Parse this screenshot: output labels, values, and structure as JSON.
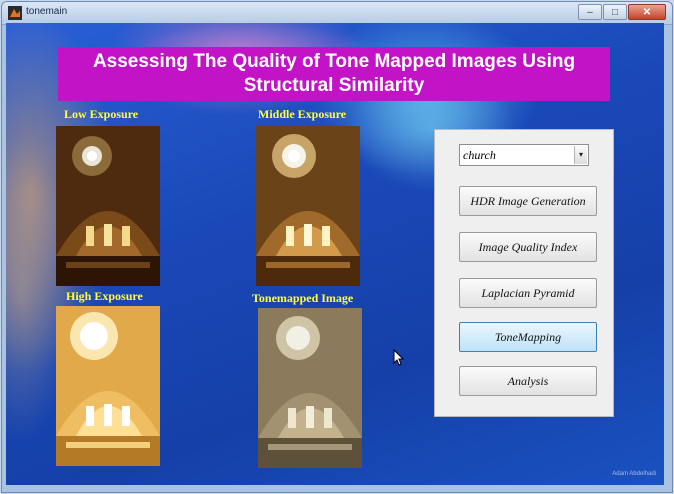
{
  "window": {
    "title": "tonemain",
    "buttons": {
      "minimize": "–",
      "maximize": "□",
      "close": "✕"
    }
  },
  "banner": {
    "line1": "Assessing The Quality of Tone Mapped Images Using",
    "line2": "Structural Similarity"
  },
  "images": {
    "low": {
      "label": "Low Exposure"
    },
    "middle": {
      "label": "Middle Exposure"
    },
    "high": {
      "label": "High Exposure"
    },
    "tonemapped": {
      "label": "Tonemapped Image"
    }
  },
  "panel": {
    "dropdown": {
      "selected": "church"
    },
    "buttons": [
      "HDR Image Generation",
      "Image Quality Index",
      "Laplacian Pyramid",
      "ToneMapping",
      "Analysis"
    ],
    "active_button": "ToneMapping"
  },
  "watermark": "Adam Abdelhadi"
}
